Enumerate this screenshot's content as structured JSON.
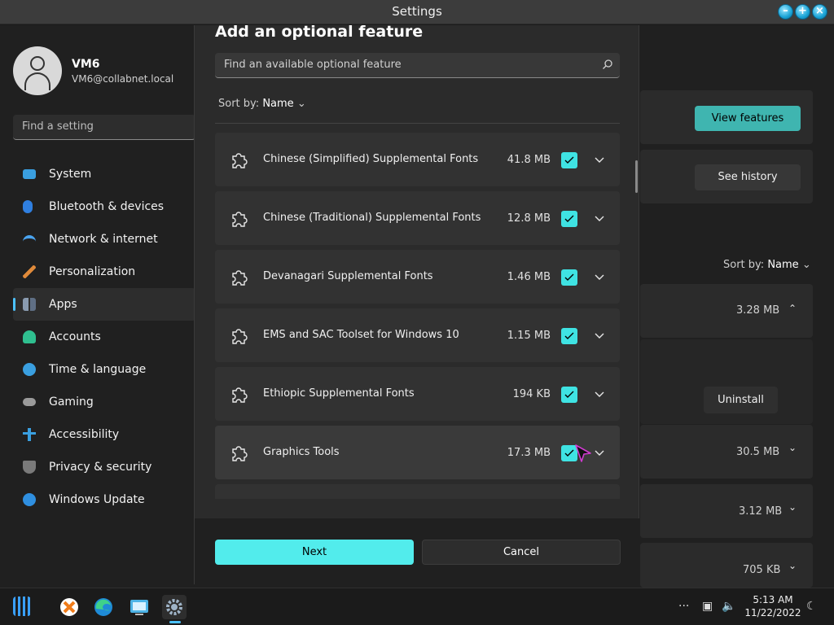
{
  "window": {
    "title": "Settings"
  },
  "profile": {
    "name": "VM6",
    "email": "VM6@collabnet.local"
  },
  "sidebar": {
    "search_placeholder": "Find a setting",
    "items": [
      {
        "label": "System",
        "icon": "monitor-icon",
        "color": "#3a9fe0"
      },
      {
        "label": "Bluetooth & devices",
        "icon": "bluetooth-icon",
        "color": "#2f7fe0"
      },
      {
        "label": "Network & internet",
        "icon": "wifi-icon",
        "color": "#4aa3ef"
      },
      {
        "label": "Personalization",
        "icon": "brush-icon",
        "color": "#e08a3a"
      },
      {
        "label": "Apps",
        "icon": "apps-icon",
        "color": "#8a9bb0",
        "active": true
      },
      {
        "label": "Accounts",
        "icon": "person-icon",
        "color": "#2fbf8f"
      },
      {
        "label": "Time & language",
        "icon": "globe-clock-icon",
        "color": "#3a9fe0"
      },
      {
        "label": "Gaming",
        "icon": "gamepad-icon",
        "color": "#9a9a9a"
      },
      {
        "label": "Accessibility",
        "icon": "accessibility-icon",
        "color": "#3a9fe0"
      },
      {
        "label": "Privacy & security",
        "icon": "shield-icon",
        "color": "#7a7a7a"
      },
      {
        "label": "Windows Update",
        "icon": "update-icon",
        "color": "#2f8fe0"
      }
    ]
  },
  "background": {
    "view_features": "View features",
    "see_history": "See history",
    "sort_label": "Sort by:",
    "sort_value": "Name",
    "uninstall": "Uninstall",
    "sizes": [
      "3.28 MB",
      "30.5 MB",
      "3.12 MB",
      "705 KB"
    ]
  },
  "dialog": {
    "title": "Add an optional feature",
    "search_placeholder": "Find an available optional feature",
    "sort_label": "Sort by:",
    "sort_value": "Name",
    "features": [
      {
        "name": "Chinese (Simplified) Supplemental Fonts",
        "size": "41.8 MB",
        "checked": true
      },
      {
        "name": "Chinese (Traditional) Supplemental Fonts",
        "size": "12.8 MB",
        "checked": true
      },
      {
        "name": "Devanagari Supplemental Fonts",
        "size": "1.46 MB",
        "checked": true
      },
      {
        "name": "EMS and SAC Toolset for Windows 10",
        "size": "1.15 MB",
        "checked": true
      },
      {
        "name": "Ethiopic Supplemental Fonts",
        "size": "194 KB",
        "checked": true
      },
      {
        "name": "Graphics Tools",
        "size": "17.3 MB",
        "checked": true
      }
    ],
    "next_label": "Next",
    "cancel_label": "Cancel"
  },
  "taskbar": {
    "time": "5:13 AM",
    "date": "11/22/2022"
  },
  "colors": {
    "accent": "#52ecec",
    "teal_button": "#3fb5b0"
  }
}
